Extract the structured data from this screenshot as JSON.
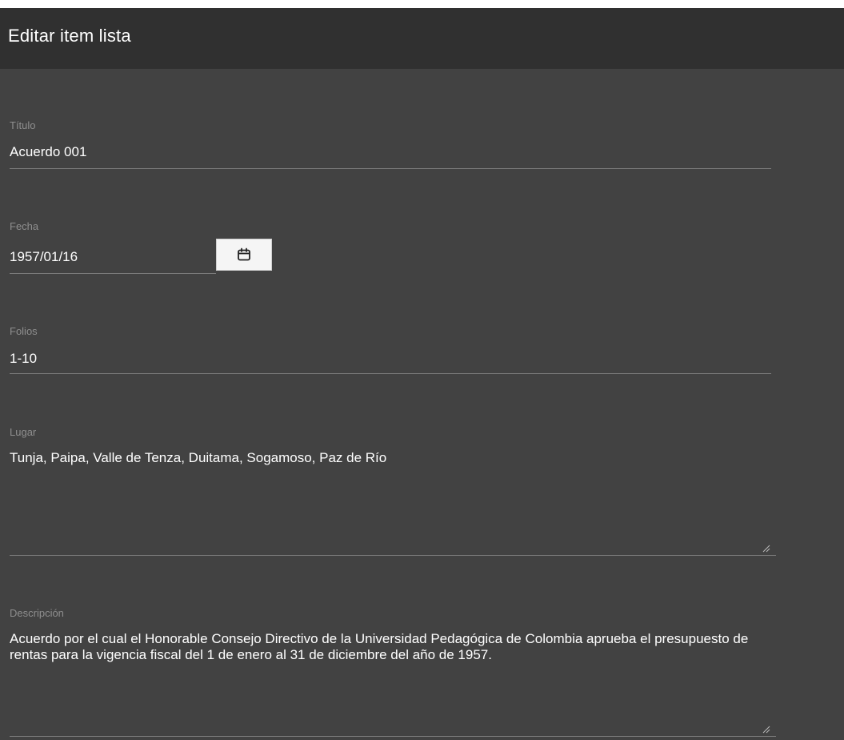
{
  "dialog": {
    "title": "Editar item lista"
  },
  "fields": {
    "titulo": {
      "label": "Título",
      "value": "Acuerdo 001"
    },
    "fecha": {
      "label": "Fecha",
      "value": "1957/01/16",
      "button_icon": "calendar-icon"
    },
    "folios": {
      "label": "Folios",
      "value": "1-10"
    },
    "lugar": {
      "label": "Lugar",
      "value": "Tunja, Paipa, Valle de Tenza, Duitama, Sogamoso, Paz de Río"
    },
    "descripcion": {
      "label": "Descripción",
      "value": "Acuerdo por el cual el Honorable Consejo Directivo de la Universidad Pedagógica de Colombia aprueba el presupuesto de rentas para la vigencia fiscal del 1 de enero al 31 de diciembre del año de 1957."
    }
  },
  "colors": {
    "header_bg": "#303030",
    "body_bg": "#424242",
    "label": "#8e8e8e",
    "text": "#ffffff",
    "underline": "#7a7a7a"
  }
}
